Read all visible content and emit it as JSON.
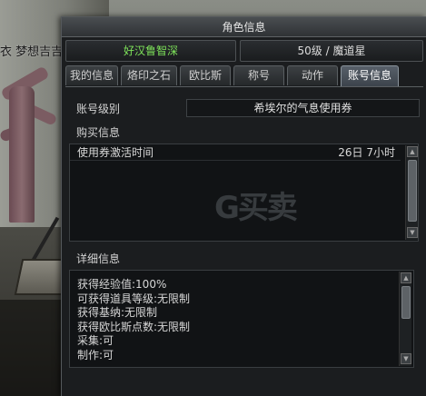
{
  "scene": {
    "chat_text": "衣 梦想吉吉"
  },
  "window": {
    "title": "角色信息",
    "character_name": "好汉鲁智深",
    "character_level": "50级 / 魔道星",
    "tabs": [
      {
        "label": "我的信息"
      },
      {
        "label": "烙印之石"
      },
      {
        "label": "欧比斯"
      },
      {
        "label": "称号"
      },
      {
        "label": "动作"
      },
      {
        "label": "账号信息",
        "active": true
      }
    ],
    "account_level_label": "账号级别",
    "account_level_value": "希埃尔的气息使用券",
    "purchase_info_label": "购买信息",
    "purchase_rows": [
      {
        "name": "使用券激活时间",
        "value": "26日 7小时"
      }
    ],
    "detail_info_label": "详细信息",
    "detail_lines": [
      "获得经验值:100%",
      "可获得道具等级:无限制",
      "获得基纳:无限制",
      "获得欧比斯点数:无限制",
      "采集:可",
      "制作:可"
    ],
    "watermark": "G买卖"
  },
  "icons": {
    "scroll_up": "arrow-up-icon",
    "scroll_down": "arrow-down-icon"
  }
}
